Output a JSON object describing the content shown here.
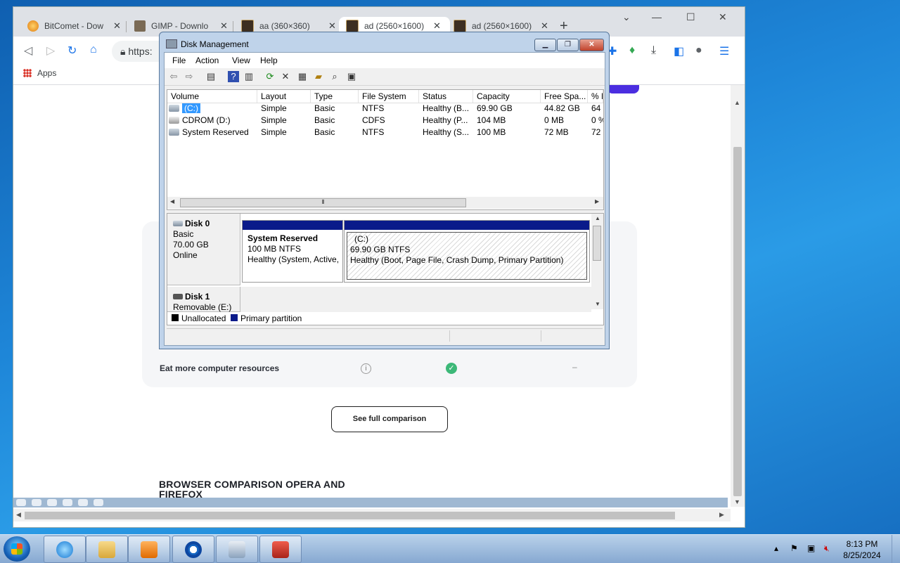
{
  "browser": {
    "tabs": [
      {
        "title": "BitComet - Dow",
        "color": "#f0a030"
      },
      {
        "title": "GIMP - Downlo",
        "color": "#6b5b45"
      },
      {
        "title": "aa (360×360)",
        "color": "#4a3a2a"
      },
      {
        "title": "ad (2560×1600)",
        "color": "#4a3a2a",
        "active": true
      },
      {
        "title": "ad (2560×1600)",
        "color": "#4a3a2a"
      }
    ],
    "close_glyph": "✕",
    "new_tab": "+",
    "url_partial": "https:",
    "apps_label": "Apps"
  },
  "page": {
    "row_label": "Eat more computer resources",
    "info_glyph": "i",
    "check_glyph": "✓",
    "dash": "–",
    "compare_button": "See full comparison",
    "heading": "BROWSER COMPARISON OPERA AND FIREFOX"
  },
  "disk_mgmt": {
    "title": "Disk Management",
    "menu": [
      "File",
      "Action",
      "View",
      "Help"
    ],
    "columns": [
      "Volume",
      "Layout",
      "Type",
      "File System",
      "Status",
      "Capacity",
      "Free Spa...",
      "% F"
    ],
    "volumes": [
      {
        "volume": "(C:)",
        "layout": "Simple",
        "type": "Basic",
        "fs": "NTFS",
        "status": "Healthy (B...",
        "capacity": "69.90 GB",
        "free": "44.82 GB",
        "pct": "64"
      },
      {
        "volume": "CDROM (D:)",
        "layout": "Simple",
        "type": "Basic",
        "fs": "CDFS",
        "status": "Healthy (P...",
        "capacity": "104 MB",
        "free": "0 MB",
        "pct": "0 %"
      },
      {
        "volume": "System Reserved",
        "layout": "Simple",
        "type": "Basic",
        "fs": "NTFS",
        "status": "Healthy (S...",
        "capacity": "100 MB",
        "free": "72 MB",
        "pct": "72"
      }
    ],
    "disks": [
      {
        "name": "Disk 0",
        "kind": "Basic",
        "size": "70.00 GB",
        "state": "Online"
      },
      {
        "name": "Disk 1",
        "kind": "Removable (E:)"
      }
    ],
    "partitions": [
      {
        "name": "System Reserved",
        "size": "100 MB NTFS",
        "status": "Healthy (System, Active,"
      },
      {
        "name": "(C:)",
        "size": "69.90 GB NTFS",
        "status": "Healthy (Boot, Page File, Crash Dump, Primary Partition)"
      }
    ],
    "legend": [
      {
        "label": "Unallocated",
        "color": "#000000"
      },
      {
        "label": "Primary partition",
        "color": "#0a1a8a"
      }
    ]
  },
  "taskbar": {
    "time": "8:13 PM",
    "date": "8/25/2024"
  }
}
